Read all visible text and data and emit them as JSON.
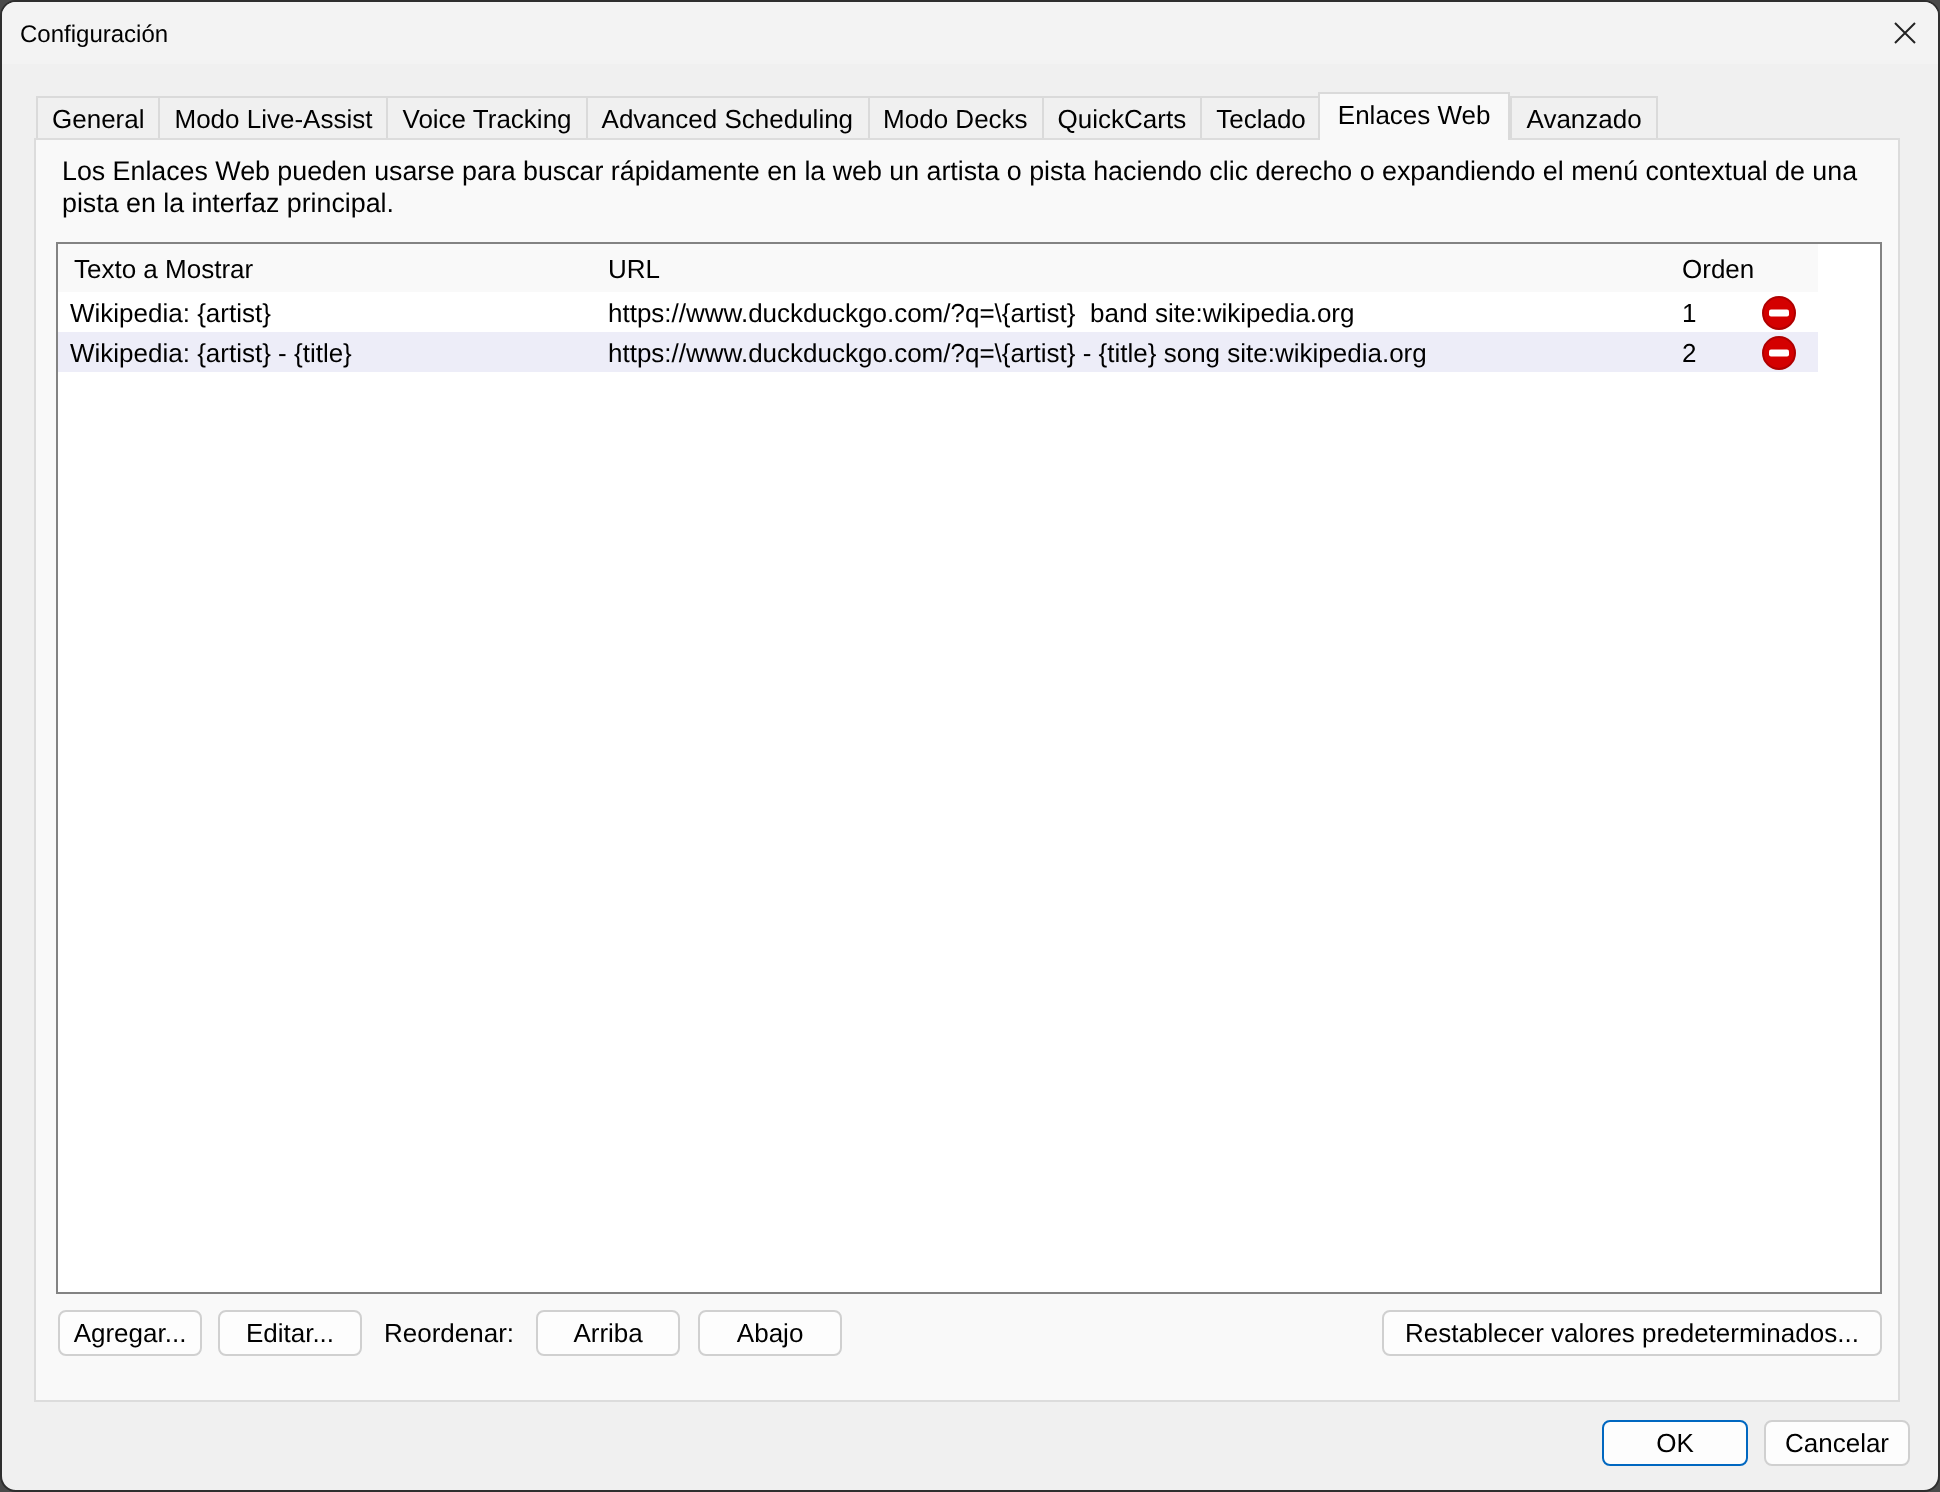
{
  "window": {
    "title": "Configuración"
  },
  "tabs": [
    {
      "label": "General",
      "selected": false
    },
    {
      "label": "Modo Live-Assist",
      "selected": false
    },
    {
      "label": "Voice Tracking",
      "selected": false
    },
    {
      "label": "Advanced Scheduling",
      "selected": false
    },
    {
      "label": "Modo Decks",
      "selected": false
    },
    {
      "label": "QuickCarts",
      "selected": false
    },
    {
      "label": "Teclado",
      "selected": false
    },
    {
      "label": "Enlaces Web",
      "selected": true
    },
    {
      "label": "Avanzado",
      "selected": false
    }
  ],
  "description": "Los Enlaces Web pueden usarse para buscar rápidamente en la web un artista o pista haciendo clic derecho o expandiendo el menú contextual de una pista en la interfaz principal.",
  "links_table": {
    "columns": [
      "Texto a Mostrar",
      "URL",
      "Orden"
    ],
    "rows": [
      {
        "display_text": "Wikipedia: {artist}",
        "url": "https://www.duckduckgo.com/?q=\\{artist}  band site:wikipedia.org",
        "order": "1",
        "selected": false
      },
      {
        "display_text": "Wikipedia: {artist} - {title}",
        "url": "https://www.duckduckgo.com/?q=\\{artist} - {title} song site:wikipedia.org",
        "order": "2",
        "selected": true
      }
    ]
  },
  "list_buttons": [
    "Agregar...",
    "Editar..."
  ],
  "reorder_label": "Reordenar:",
  "reorder_buttons": [
    "Arriba",
    "Abajo"
  ],
  "reset_button": "Restablecer valores predeterminados...",
  "dialog_buttons": [
    {
      "label": "OK",
      "default": true
    },
    {
      "label": "Cancelar",
      "default": false
    }
  ]
}
